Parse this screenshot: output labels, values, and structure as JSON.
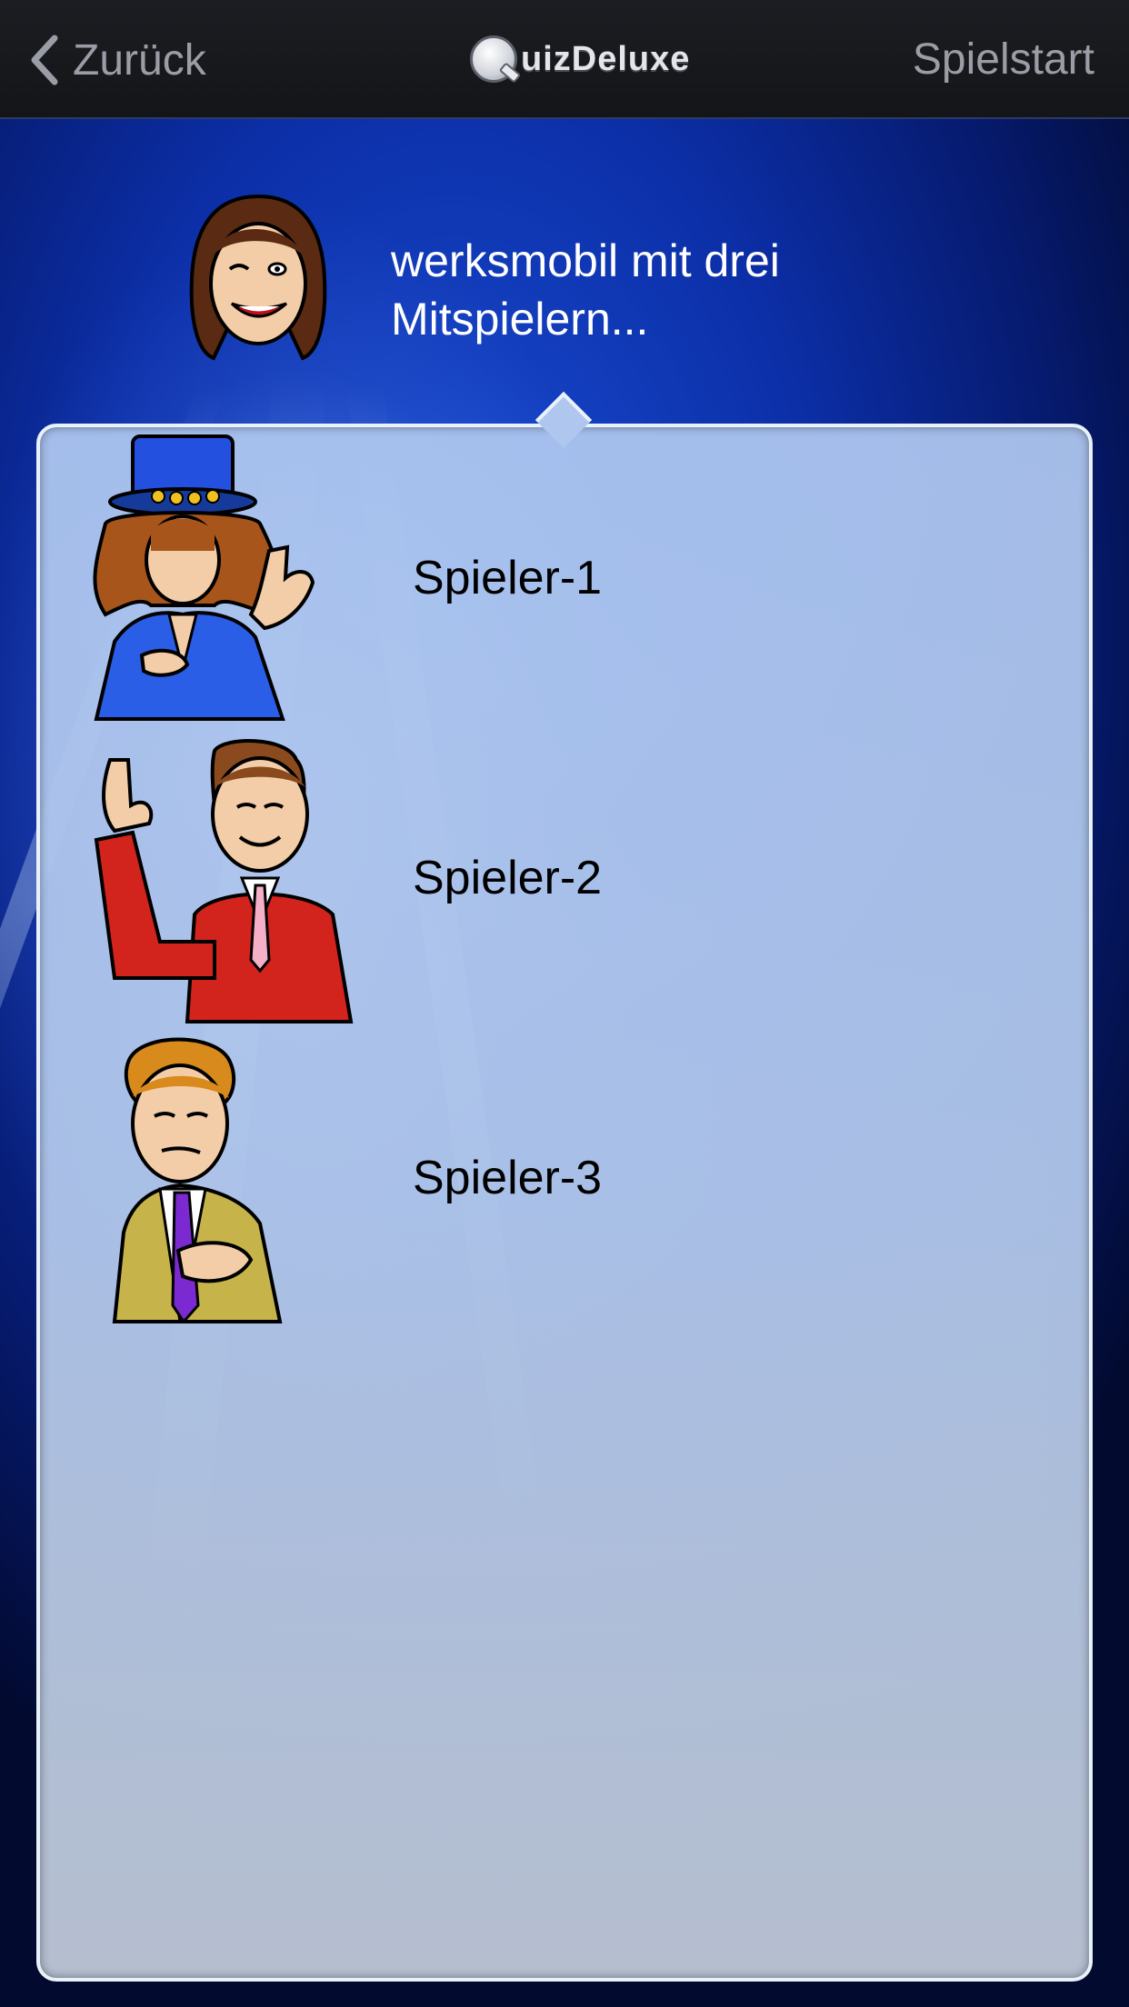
{
  "navbar": {
    "back_label": "Zurück",
    "logo_text": "uizDeluxe",
    "start_label": "Spielstart"
  },
  "host": {
    "avatar_icon": "host-woman-avatar-icon",
    "message_line1": "werksmobil mit drei",
    "message_line2": "Mitspielern..."
  },
  "players": [
    {
      "name": "Spieler-1",
      "avatar_icon": "rocker-avatar-icon",
      "jacket_color": "#1f4fd6"
    },
    {
      "name": "Spieler-2",
      "avatar_icon": "businessman-red-avatar-icon",
      "jacket_color": "#d0201c"
    },
    {
      "name": "Spieler-3",
      "avatar_icon": "man-olive-jacket-avatar-icon",
      "jacket_color": "#c6b44a"
    }
  ],
  "colors": {
    "navbar_bg": "#17181c",
    "nav_text": "#9a9da6",
    "panel_border": "#e9f2fb",
    "panel_bg": "#b2c8ee"
  }
}
